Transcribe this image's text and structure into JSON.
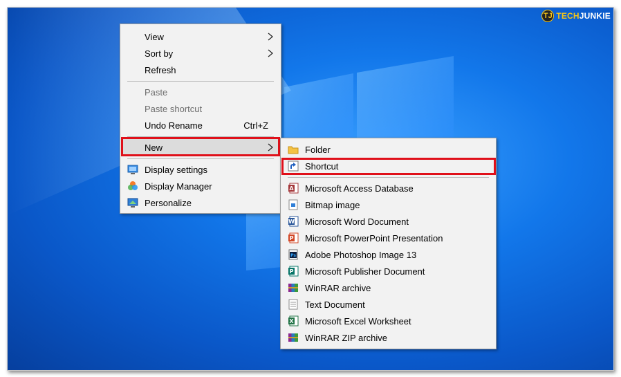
{
  "brand": {
    "badge": "TJ",
    "tech": "TECH",
    "junkie": "JUNKIE"
  },
  "context_menu": {
    "items": [
      {
        "label": "View",
        "submenu": true
      },
      {
        "label": "Sort by",
        "submenu": true
      },
      {
        "label": "Refresh"
      },
      {
        "label": "Paste",
        "disabled": true
      },
      {
        "label": "Paste shortcut",
        "disabled": true
      },
      {
        "label": "Undo Rename",
        "shortcut": "Ctrl+Z"
      },
      {
        "label": "New",
        "submenu": true,
        "highlighted": true
      },
      {
        "label": "Display settings",
        "icon": "display-settings-icon"
      },
      {
        "label": "Display Manager",
        "icon": "display-manager-icon"
      },
      {
        "label": "Personalize",
        "icon": "personalize-icon"
      }
    ]
  },
  "new_submenu": {
    "items": [
      {
        "label": "Folder",
        "icon": "folder-icon"
      },
      {
        "label": "Shortcut",
        "icon": "shortcut-icon",
        "highlighted": true
      },
      {
        "label": "Microsoft Access Database",
        "icon": "access-icon"
      },
      {
        "label": "Bitmap image",
        "icon": "bitmap-icon"
      },
      {
        "label": "Microsoft Word Document",
        "icon": "word-icon"
      },
      {
        "label": "Microsoft PowerPoint Presentation",
        "icon": "powerpoint-icon"
      },
      {
        "label": "Adobe Photoshop Image 13",
        "icon": "photoshop-icon"
      },
      {
        "label": "Microsoft Publisher Document",
        "icon": "publisher-icon"
      },
      {
        "label": "WinRAR archive",
        "icon": "winrar-icon"
      },
      {
        "label": "Text Document",
        "icon": "text-document-icon"
      },
      {
        "label": "Microsoft Excel Worksheet",
        "icon": "excel-icon"
      },
      {
        "label": "WinRAR ZIP archive",
        "icon": "winrar-zip-icon"
      }
    ]
  },
  "colors": {
    "highlight_border": "#e0101a",
    "menu_bg": "#f2f2f2",
    "desktop": "#1277ea"
  }
}
